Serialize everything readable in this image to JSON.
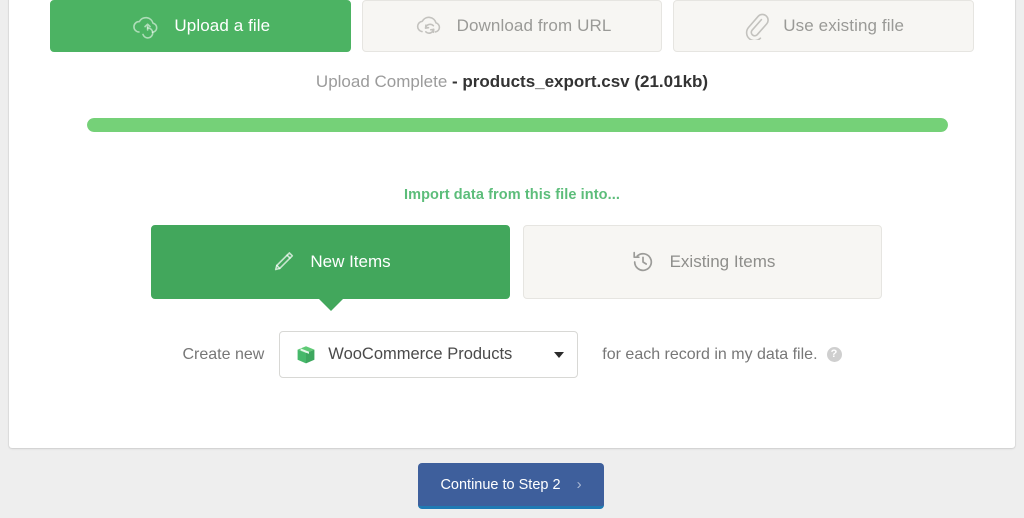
{
  "source_tabs": [
    {
      "label": "Upload a file",
      "icon": "cloud-upload-icon",
      "state": "active"
    },
    {
      "label": "Download from URL",
      "icon": "cloud-sync-icon",
      "state": "inactive"
    },
    {
      "label": "Use existing file",
      "icon": "paperclip-icon",
      "state": "inactive"
    }
  ],
  "upload": {
    "status_label": "Upload Complete",
    "separator": "-",
    "file_name": "products_export.csv",
    "file_size": "(21.01kb)",
    "file_summary": "products_export.csv (21.01kb)",
    "progress_percent": 100,
    "progress_color": "#75d178"
  },
  "import": {
    "heading": "Import data from this file into...",
    "heading_color": "#5cbd7a",
    "modes": [
      {
        "label": "New Items",
        "icon": "pencil-icon",
        "state": "active"
      },
      {
        "label": "Existing Items",
        "icon": "history-clock-icon",
        "state": "inactive"
      }
    ]
  },
  "create_row": {
    "prefix": "Create new",
    "selected_option": "WooCommerce Products",
    "select_icon": "woocommerce-box-icon",
    "suffix": "for each record in my data file.",
    "help_icon": "?"
  },
  "footer": {
    "continue_label": "Continue to Step 2",
    "continue_chevron": "›",
    "continue_color": "#3e5f9c"
  },
  "theme": {
    "accent_green": "#4cb363",
    "mode_green": "#42a75c",
    "page_background": "#eeeeee",
    "card_background": "#ffffff"
  }
}
